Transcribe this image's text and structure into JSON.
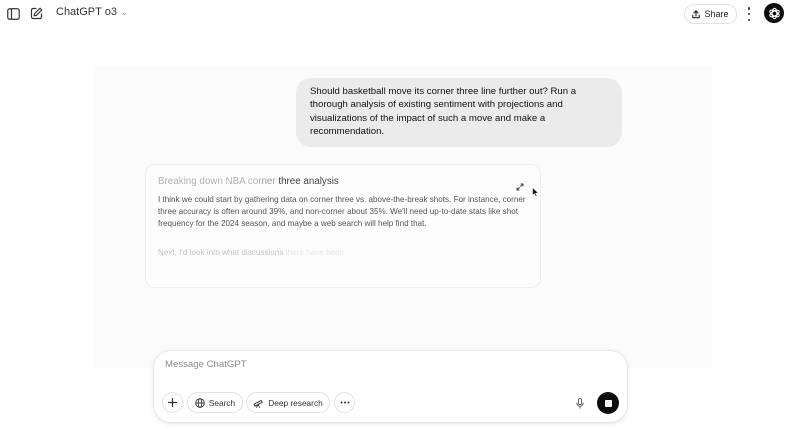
{
  "header": {
    "model_name": "ChatGPT o3",
    "share_label": "Share"
  },
  "conversation": {
    "user_message": "Should basketball move its corner three line further out? Run a thorough analysis of existing sentiment with projections and visualizations of the impact of such a move and make a recommendation.",
    "reasoning": {
      "title_faded": "Breaking down NBA cor",
      "title_dim": "ner ",
      "title_lit": "three analysis",
      "body": "I think we could start by gathering data on corner three vs. above-the-break shots. For instance, corner three accuracy is often around 39%, and non-corner about 35%. We'll need up-to-date stats like shot frequency for the 2024 season, and maybe a web search will help find that.",
      "next_visible": "Next, I'd look into what discussions ",
      "next_faded": "there have been"
    }
  },
  "composer": {
    "placeholder": "Message ChatGPT",
    "search_label": "Search",
    "deep_research_label": "Deep research"
  },
  "icons": {
    "sidebar_toggle": "sidebar-toggle-icon",
    "new_chat": "compose-icon",
    "share": "share-upload-icon",
    "more": "more-vertical-icon",
    "avatar": "openai-logo-icon",
    "expand": "expand-icon",
    "add": "plus-icon",
    "search": "globe-icon",
    "deep_research": "telescope-icon",
    "tools": "more-horizontal-icon",
    "mic": "microphone-icon",
    "stop": "stop-icon"
  },
  "colors": {
    "user_bubble": "#ebebeb",
    "stop_button": "#0d0d0d"
  }
}
